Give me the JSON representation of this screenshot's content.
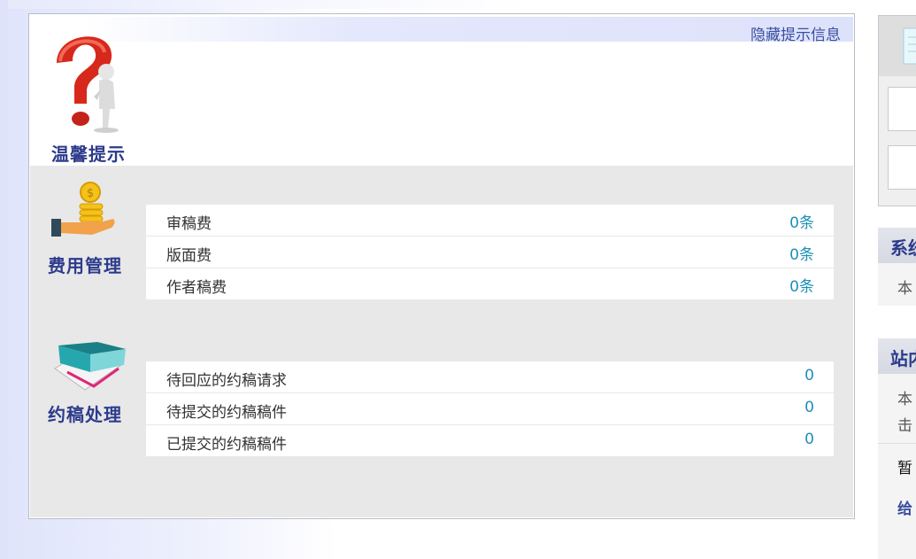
{
  "tips": {
    "hide_label": "隐藏提示信息",
    "title": "温馨提示"
  },
  "fees": {
    "title": "费用管理",
    "rows": [
      {
        "label": "审稿费",
        "count": "0条"
      },
      {
        "label": "版面费",
        "count": "0条"
      },
      {
        "label": "作者稿费",
        "count": "0条"
      }
    ]
  },
  "invitations": {
    "title": "约稿处理",
    "rows": [
      {
        "label": "待回应的约稿请求",
        "count": "0"
      },
      {
        "label": "待提交的约稿稿件",
        "count": "0"
      },
      {
        "label": "已提交的约稿稿件",
        "count": "0"
      }
    ]
  },
  "sidebar": {
    "system_title": "系统",
    "system_text": "本",
    "site_title": "站内",
    "site_text_1": "本",
    "site_text_2": "击",
    "empty_text": "暂",
    "link_text": "给"
  },
  "colors": {
    "accent": "#2d3b8c",
    "count": "#1d8fb8",
    "panel_gray": "#e8e8e8"
  },
  "icons": [
    "question-mark-figure-icon",
    "coins-hand-icon",
    "envelope-box-icon",
    "document-icon"
  ]
}
